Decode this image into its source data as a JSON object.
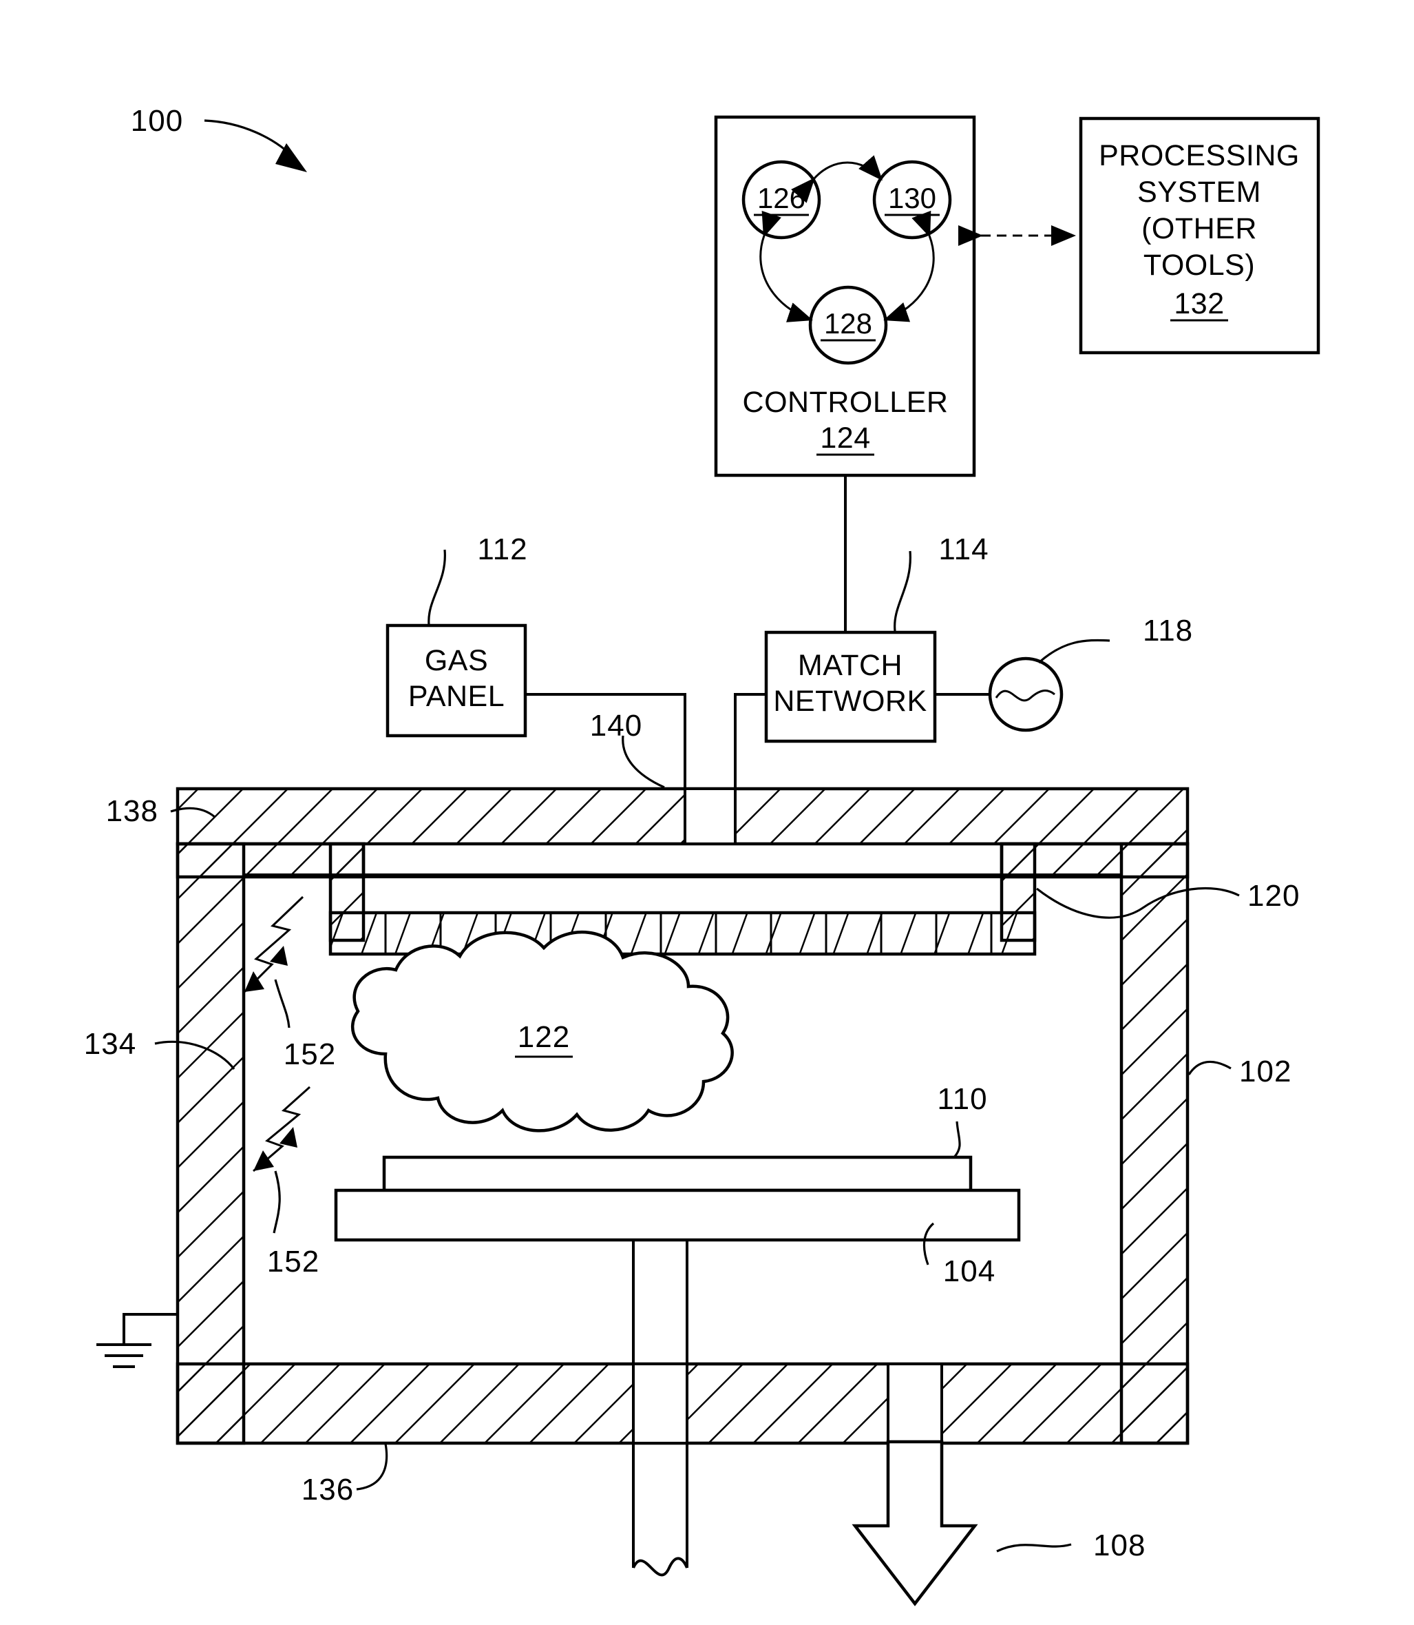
{
  "figure": {
    "number": "100",
    "title_ref": "100"
  },
  "blocks": {
    "controller": {
      "label": "CONTROLLER",
      "ref": "124",
      "nodes": [
        {
          "ref": "126"
        },
        {
          "ref": "130"
        },
        {
          "ref": "128"
        }
      ]
    },
    "processing_system": {
      "line1": "PROCESSING",
      "line2": "SYSTEM",
      "line3": "(OTHER",
      "line4": "TOOLS)",
      "ref": "132"
    },
    "gas_panel": {
      "line1": "GAS",
      "line2": "PANEL",
      "ref": "112"
    },
    "match_network": {
      "line1": "MATCH",
      "line2": "NETWORK",
      "ref": "114"
    },
    "rf_source": {
      "ref": "118",
      "icon": "ac-source-sine"
    }
  },
  "reference_numerals": {
    "figure_callout": "100",
    "gas_panel": "112",
    "match_network": "114",
    "rf_source": "118",
    "gas_inlet": "140",
    "lid": "138",
    "showerhead": "120",
    "chamber_wall": "102",
    "chamber_interior_liner": "134",
    "chamber_bottom": "136",
    "plasma": "122",
    "substrate": "110",
    "pedestal": "104",
    "exhaust": "108",
    "arc_upper": "152",
    "arc_lower": "152",
    "controller": "124",
    "controller_node_a": "126",
    "controller_node_b": "130",
    "controller_node_c": "128",
    "processing_system": "132"
  },
  "icons": {
    "ground_symbol": "ground-icon",
    "arc_symbol": "lightning-arc-icon",
    "exhaust_arrow": "down-arrow-icon",
    "sine_wave": "sine-wave-icon"
  },
  "colors": {
    "line": "#000000",
    "background": "#ffffff"
  }
}
